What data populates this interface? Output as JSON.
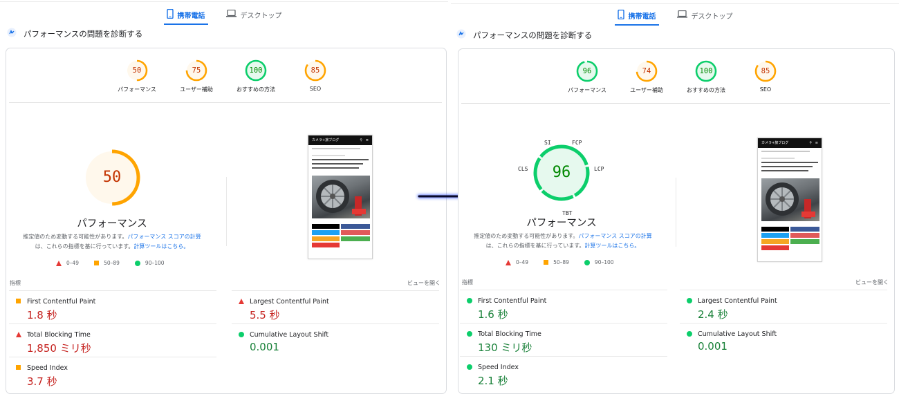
{
  "tabs": {
    "mobile": "携帯電話",
    "desktop": "デスクトップ"
  },
  "section_title": "パフォーマンスの問題を診断する",
  "common": {
    "performance_title": "パフォーマンス",
    "explain_text_1": "推定値のため変動する可能性があります。",
    "explain_link_1": "パフォーマンス スコアの計算",
    "explain_text_2": "は、これらの指標を基に行っています。",
    "explain_link_2": "計算ツールはこちら。",
    "legend": {
      "fail": "0–49",
      "average": "50–89",
      "pass": "90–100"
    },
    "metrics_label": "指標",
    "expand_view": "ビューを開く",
    "metric_names": {
      "fcp": "First Contentful Paint",
      "lcp": "Largest Contentful Paint",
      "tbt": "Total Blocking Time",
      "cls": "Cumulative Layout Shift",
      "si": "Speed Index"
    },
    "phone_preview": {
      "site_title": "カメラ+旅ブログ"
    }
  },
  "before": {
    "categories": [
      {
        "label": "パフォーマンス",
        "score": "50",
        "level": "average"
      },
      {
        "label": "ユーザー補助",
        "score": "75",
        "level": "average"
      },
      {
        "label": "おすすめの方法",
        "score": "100",
        "level": "pass"
      },
      {
        "label": "SEO",
        "score": "85",
        "level": "average"
      }
    ],
    "performance_score": "50",
    "metrics": {
      "fcp": "1.8 秒",
      "lcp": "5.5 秒",
      "tbt": "1,850 ミリ秒",
      "cls": "0.001",
      "si": "3.7 秒"
    }
  },
  "after": {
    "categories": [
      {
        "label": "パフォーマンス",
        "score": "96",
        "level": "pass"
      },
      {
        "label": "ユーザー補助",
        "score": "74",
        "level": "average"
      },
      {
        "label": "おすすめの方法",
        "score": "100",
        "level": "pass"
      },
      {
        "label": "SEO",
        "score": "85",
        "level": "average"
      }
    ],
    "performance_score": "96",
    "gauge_labels": {
      "si": "SI",
      "fcp": "FCP",
      "lcp": "LCP",
      "cls": "CLS",
      "tbt": "TBT"
    },
    "metrics": {
      "fcp": "1.6 秒",
      "lcp": "2.4 秒",
      "tbt": "130 ミリ秒",
      "cls": "0.001",
      "si": "2.1 秒"
    }
  },
  "colors": {
    "pass": "#0cce6b",
    "average": "#ffa400",
    "fail": "#ff4e42",
    "pass_text": "#008800",
    "average_text": "#c33300",
    "accent": "#1a73e8"
  }
}
